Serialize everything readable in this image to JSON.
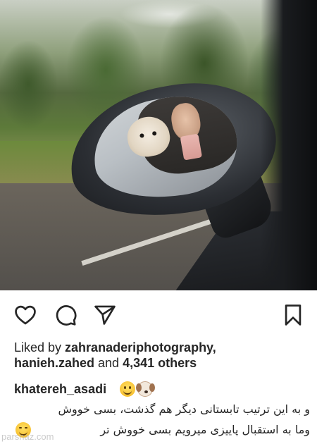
{
  "post": {
    "photo_alt": "",
    "liked_by_prefix": "Liked by ",
    "liked_by_user_1": "zahranaderiphotography,",
    "liked_by_user_2": "hanieh.zahed",
    "liked_by_and": " and ",
    "liked_by_count": "4,341 others",
    "caption_username": "khatereh_asadi",
    "caption_emojis": [
      "smiling-face",
      "dog-face"
    ],
    "caption_line_1": "و به این ترتیب تابستانی دیگر هم گذشت، بسی خووش",
    "caption_line_2": "وما به استقبال پاییزی میرویم بسی خووش تر",
    "caption_line_2_emoji": "winking-face"
  },
  "actions": {
    "like_icon": "heart-icon",
    "comment_icon": "comment-icon",
    "share_icon": "paper-plane-icon",
    "save_icon": "bookmark-icon"
  },
  "watermark": "parsnaz.com",
  "colors": {
    "text": "#262626",
    "background": "#ffffff"
  }
}
